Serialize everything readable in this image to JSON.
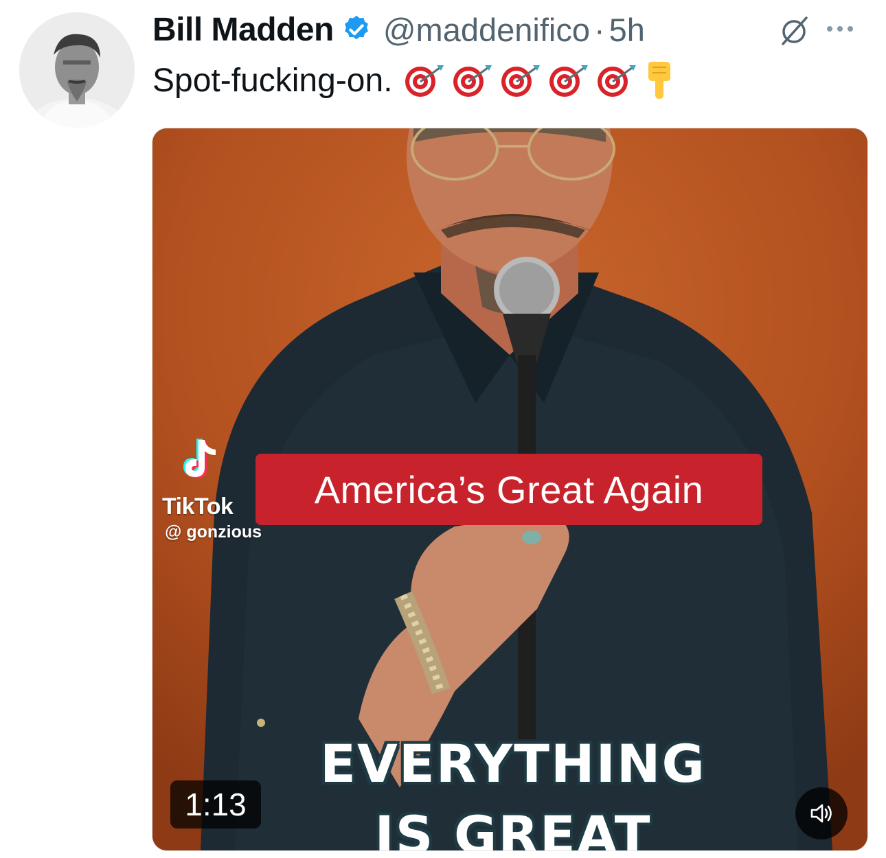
{
  "author": {
    "display_name": "Bill Madden",
    "handle": "@maddenifico",
    "separator": "·",
    "time": "5h",
    "verified_color": "#1d9bf0"
  },
  "tweet": {
    "text": "Spot-fucking-on.",
    "emojis": [
      "target-emoji",
      "target-emoji",
      "target-emoji",
      "target-emoji",
      "target-emoji",
      "pointing-down-emoji"
    ]
  },
  "media": {
    "type": "video",
    "tiktok_wordmark": "TikTok",
    "tiktok_handle": "@ gonzious",
    "banner_text": "America’s Great Again",
    "caption_line1": "EVERYTHING",
    "caption_line2": "IS GREAT",
    "duration": "1:13",
    "banner_color": "#c8232c"
  },
  "icons": {
    "grok": "grok-icon",
    "more": "more-icon",
    "volume": "volume-icon"
  }
}
